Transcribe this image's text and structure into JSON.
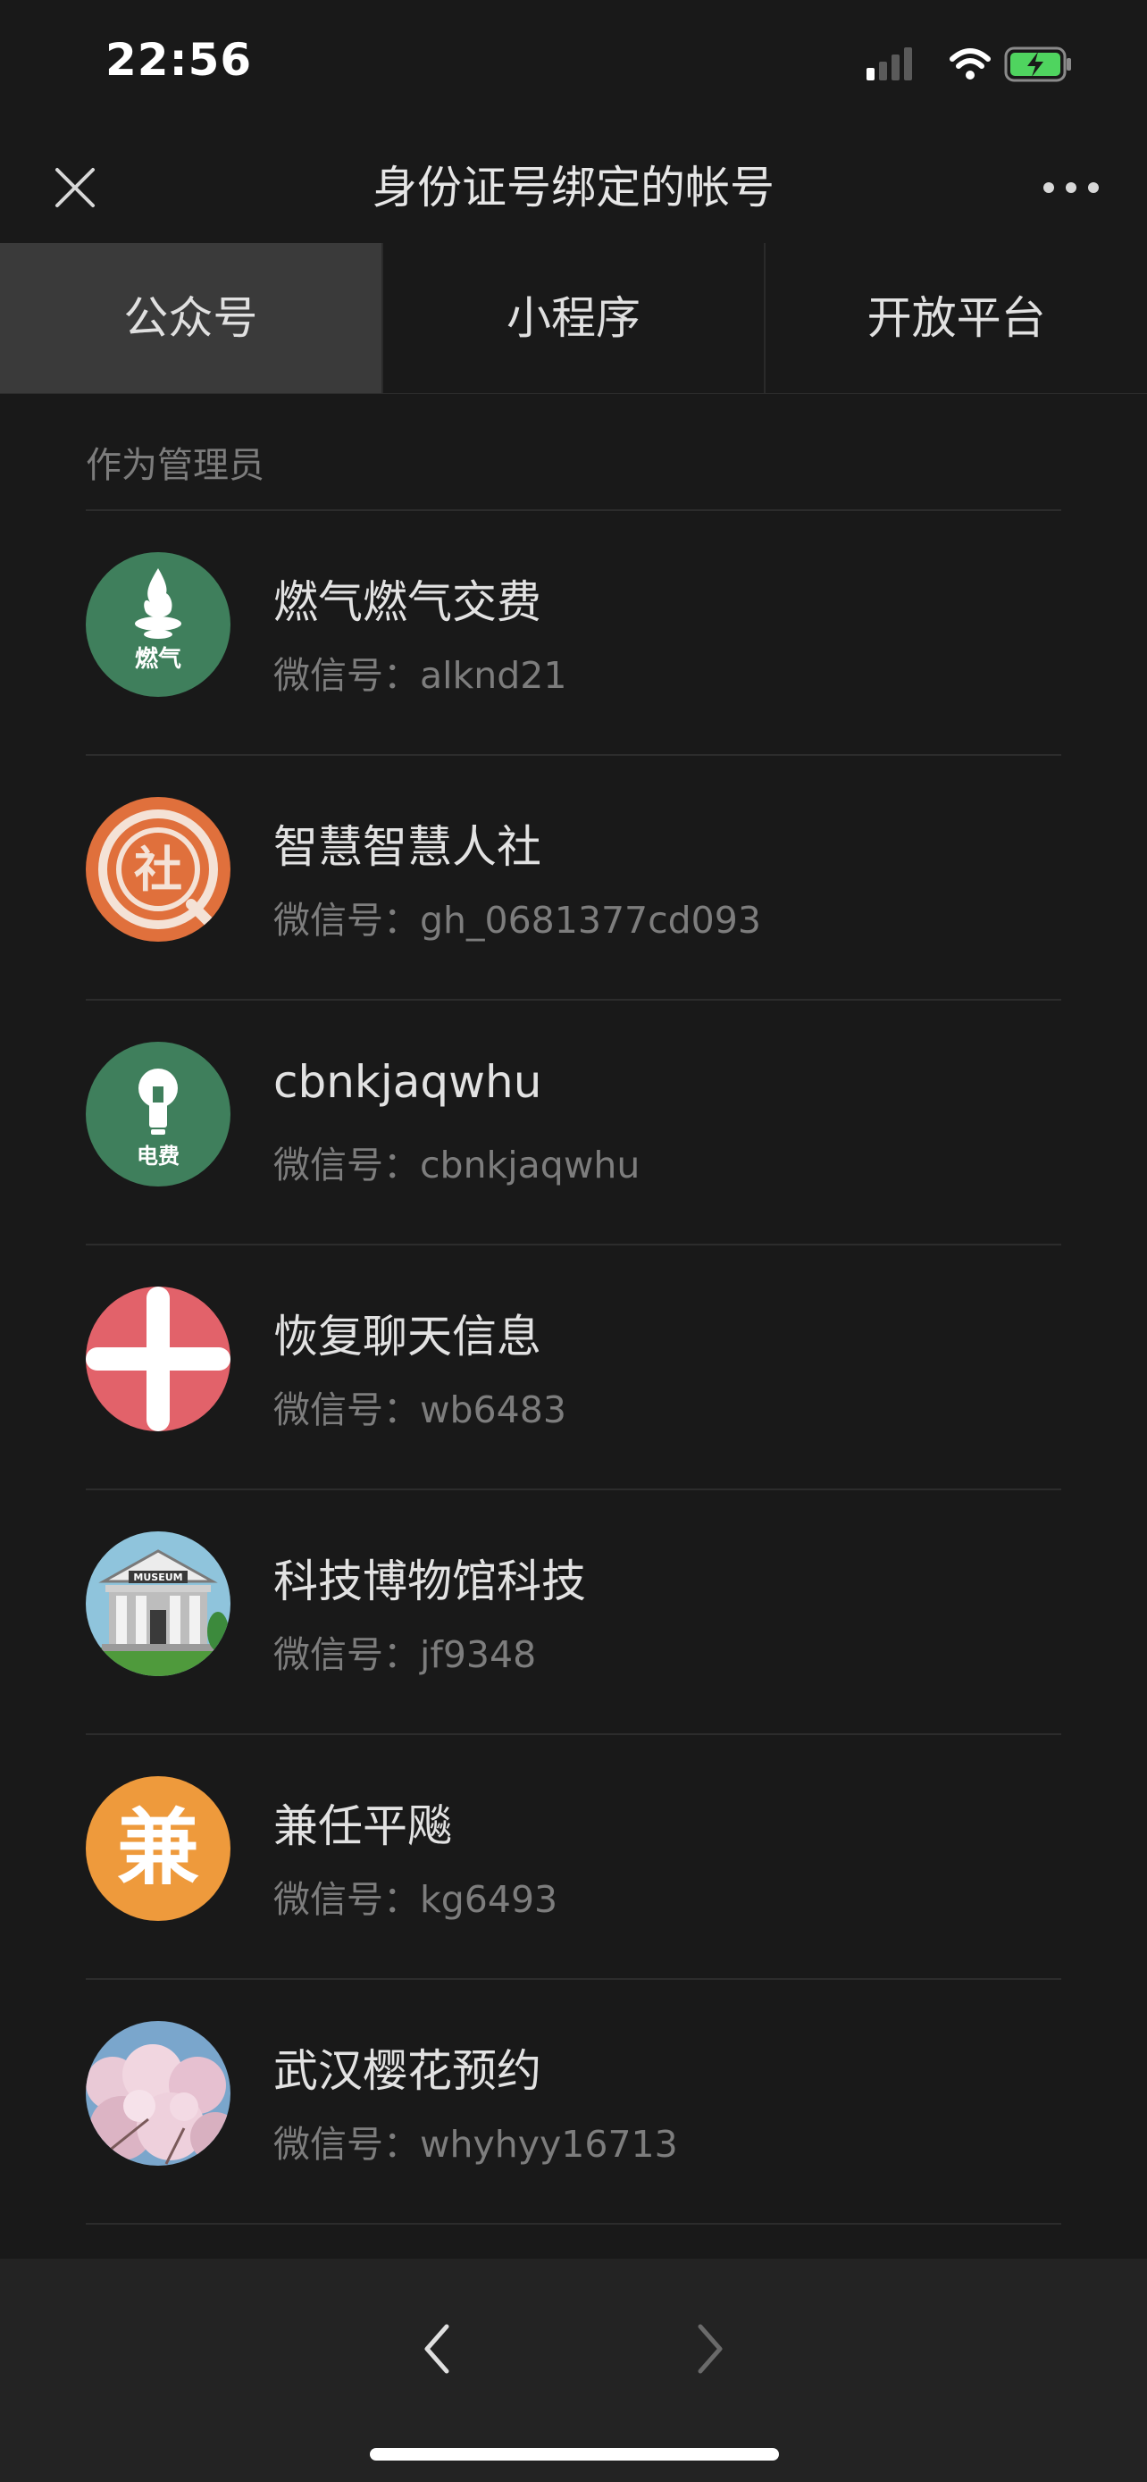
{
  "status_bar": {
    "time": "22:56"
  },
  "header": {
    "title": "身份证号绑定的帐号"
  },
  "tabs": [
    {
      "label": "公众号",
      "active": true
    },
    {
      "label": "小程序",
      "active": false
    },
    {
      "label": "开放平台",
      "active": false
    }
  ],
  "section": {
    "label": "作为管理员"
  },
  "id_prefix": "微信号：",
  "accounts": [
    {
      "name": "燃气燃气交费",
      "id": "alknd21",
      "avatar_icon": "gas-flame-icon",
      "avatar_text": "燃气",
      "avatar_color": "#3f7f5c"
    },
    {
      "name": "智慧智慧人社",
      "id": "gh_0681377cd093",
      "avatar_icon": "social-security-icon",
      "avatar_text": "社",
      "avatar_color": "#e0703c"
    },
    {
      "name": "cbnkjaqwhu",
      "id": "cbnkjaqwhu",
      "avatar_icon": "lightbulb-icon",
      "avatar_text": "电费",
      "avatar_color": "#3f7f5c"
    },
    {
      "name": "恢复聊天信息",
      "id": "wb6483",
      "avatar_icon": "plus-cross-icon",
      "avatar_color": "#e2626a"
    },
    {
      "name": "科技博物馆科技",
      "id": "jf9348",
      "avatar_icon": "museum-icon",
      "avatar_text": "MUSEUM",
      "avatar_color": "#8fc4dc"
    },
    {
      "name": "兼任平飚",
      "id": "kg6493",
      "avatar_icon": "jian-character-icon",
      "avatar_text": "兼",
      "avatar_color": "#ee9a3c"
    },
    {
      "name": "武汉樱花预约",
      "id": "whyhyy16713",
      "avatar_icon": "cherry-blossom-icon",
      "avatar_color": "#c9a8b8"
    }
  ]
}
